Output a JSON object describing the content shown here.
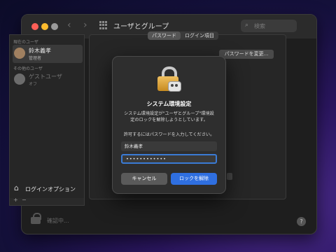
{
  "window": {
    "title": "ユーザとグループ"
  },
  "search": {
    "placeholder": "検索",
    "icon": "search-icon"
  },
  "colors": {
    "close": "#ff5f57",
    "minimize": "#febc2e",
    "zoom": "#9a9a9a",
    "accent": "#2f6fe0"
  },
  "sidebar": {
    "current_user_header": "現在のユーザ",
    "other_users_header": "その他のユーザ",
    "users": [
      {
        "name": "鈴木義孝",
        "role": "管理者"
      },
      {
        "name": "ゲストユーザ",
        "role": "オフ"
      }
    ],
    "login_options_label": "ログインオプション",
    "add_label": "+",
    "remove_label": "−"
  },
  "tabs": [
    {
      "label": "パスワード",
      "active": true
    },
    {
      "label": "ログイン項目",
      "active": false
    }
  ],
  "change_password_label": "パスワードを変更...",
  "footer": {
    "lock_status": "確認中...",
    "help_label": "?"
  },
  "dialog": {
    "title": "システム環境設定",
    "message_line1": "システム環境設定が\"ユーザとグループ\"環境設",
    "message_line2": "定のロックを解除しようとしています。",
    "prompt": "許可するにはパスワードを入力してください。",
    "username": "鈴木義孝",
    "password_mask": "••••••••••••",
    "cancel_label": "キャンセル",
    "unlock_label": "ロックを解除"
  }
}
